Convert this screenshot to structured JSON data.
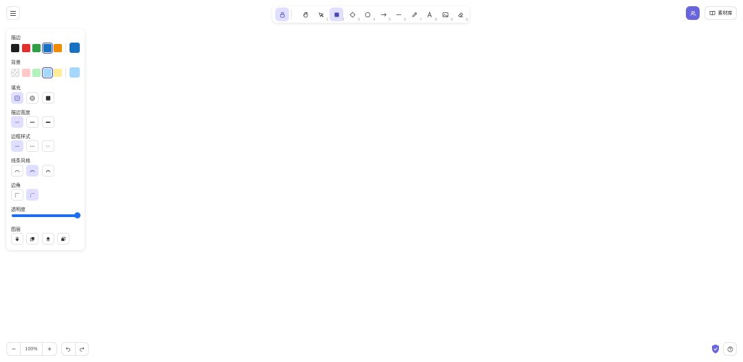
{
  "toolbar": {
    "tools": [
      {
        "name": "hand",
        "key": ""
      },
      {
        "name": "selection",
        "key": "1"
      },
      {
        "name": "rectangle",
        "key": "2"
      },
      {
        "name": "diamond",
        "key": "3"
      },
      {
        "name": "ellipse",
        "key": "4"
      },
      {
        "name": "arrow",
        "key": "5"
      },
      {
        "name": "line",
        "key": "6"
      },
      {
        "name": "draw",
        "key": "7"
      },
      {
        "name": "text",
        "key": "8"
      },
      {
        "name": "image",
        "key": "9"
      },
      {
        "name": "eraser",
        "key": "0"
      }
    ],
    "active_tool": "rectangle"
  },
  "library": {
    "label": "素材库"
  },
  "panel": {
    "stroke": {
      "label": "描边",
      "colors": [
        "#1e1e1e",
        "#e03131",
        "#2f9e44",
        "#1971c2",
        "#f08c00"
      ],
      "selected": "#1971c2"
    },
    "background": {
      "label": "背景",
      "colors": [
        "transparent",
        "#ffc9c9",
        "#b2f2bb",
        "#a5d8ff",
        "#ffec99"
      ],
      "selected": "#a5d8ff"
    },
    "fill": {
      "label": "填充",
      "selected": "hachure"
    },
    "stroke_width": {
      "label": "描边宽度",
      "selected": "thin"
    },
    "stroke_style": {
      "label": "边框样式",
      "selected": "solid"
    },
    "sloppiness": {
      "label": "线条风格",
      "selected": "artist"
    },
    "edges": {
      "label": "边角",
      "selected": "round"
    },
    "opacity": {
      "label": "透明度",
      "value": 100
    },
    "layers": {
      "label": "图层"
    }
  },
  "zoom": {
    "level": "100%"
  },
  "colors": {
    "accent": "#6965db",
    "accent_light": "#e0dfff",
    "slider": "#1d6ef2"
  }
}
